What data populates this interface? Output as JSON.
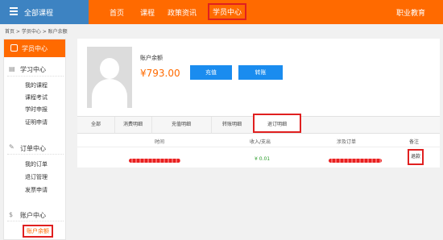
{
  "header": {
    "all_courses": "全部课程",
    "nav": [
      "首页",
      "课程",
      "政策资讯",
      "学员中心"
    ],
    "brand": "职业教育"
  },
  "breadcrumb": "首页 > 学员中心 > 账户余额",
  "sidebar": {
    "title": "学员中心",
    "sections": [
      {
        "title": "学习中心",
        "items": [
          "我的课程",
          "课程考试",
          "学时申报",
          "证明申请"
        ]
      },
      {
        "title": "订单中心",
        "items": [
          "我的订单",
          "退订管理",
          "发票申请"
        ]
      },
      {
        "title": "账户中心",
        "items": [
          "账户余额"
        ]
      }
    ]
  },
  "account": {
    "balance_title": "账户余额",
    "balance": "¥793.00",
    "recharge_label": "充值",
    "transfer_label": "转账"
  },
  "tabs": [
    "全部",
    "消费明细",
    "充值明细",
    "转账明细",
    "退订明细"
  ],
  "table": {
    "columns": [
      "时间",
      "收入/支出",
      "涉及订单",
      "备注"
    ],
    "rows": [
      {
        "amount": "¥ 0.01",
        "remark": "退款"
      }
    ]
  },
  "colors": {
    "accent": "#ff6a00",
    "primary": "#1a8cef",
    "highlight": "#e02020",
    "income": "#2a9c2a"
  }
}
